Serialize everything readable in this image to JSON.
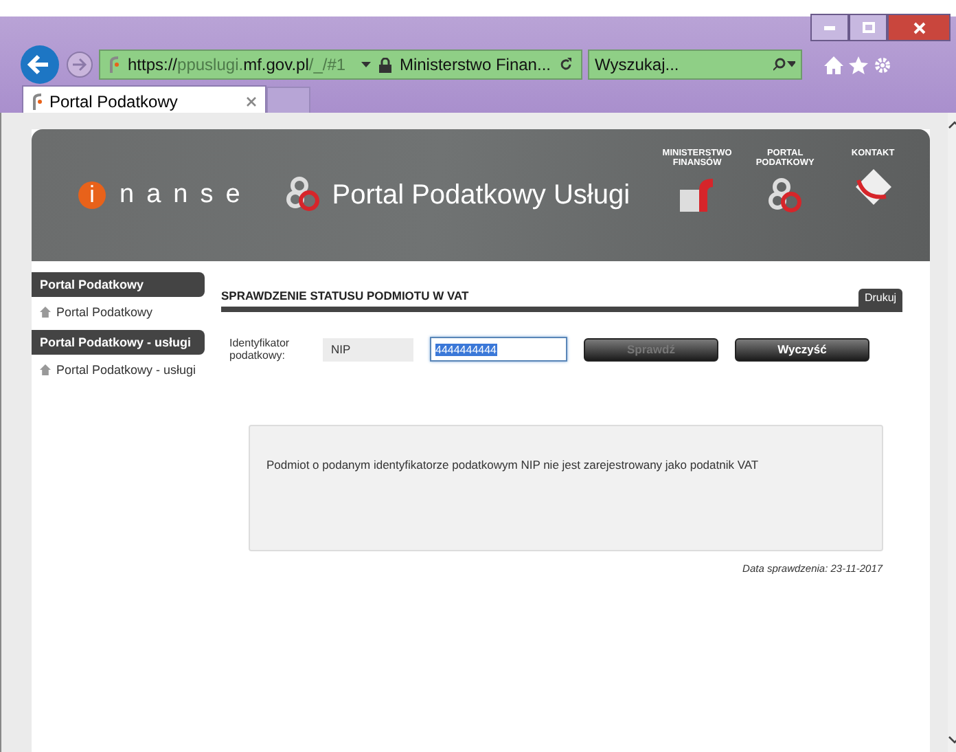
{
  "browser": {
    "url": [
      {
        "text": "https://",
        "dim": false
      },
      {
        "text": "ppuslugi.",
        "dim": true
      },
      {
        "text": "mf.gov.pl",
        "dim": false
      },
      {
        "text": "/_/#1",
        "dim": true
      }
    ],
    "site_identity": "Ministerstwo Finan...",
    "search": {
      "placeholder": "Wyszukaj..."
    },
    "tabs": [
      {
        "label": "Portal Podatkowy",
        "selected": true
      }
    ]
  },
  "header": {
    "logo_mark": "i",
    "logo_text": "nanse",
    "title": "Portal Podatkowy Usługi",
    "nav": [
      {
        "kind": "ministry",
        "label": "MINISTERSTWO FINANSÓW"
      },
      {
        "kind": "portal",
        "label": "PORTAL PODATKOWY"
      },
      {
        "kind": "contact",
        "label": "KONTAKT"
      }
    ]
  },
  "sidebar": {
    "items": [
      {
        "kind": "heading",
        "label": "Portal Podatkowy"
      },
      {
        "kind": "link",
        "label": "Portal Podatkowy"
      },
      {
        "kind": "heading",
        "label": "Portal Podatkowy - usługi"
      },
      {
        "kind": "link",
        "label": "Portal Podatkowy - usługi"
      }
    ]
  },
  "main": {
    "title": "SPRAWDZENIE STATUSU PODMIOTU W VAT",
    "print_button": "Drukuj",
    "form": {
      "label": "Identyfikator podatkowy:",
      "id_type": "NIP",
      "value": "4444444444",
      "value_selected": true,
      "buttons": [
        {
          "label": "Sprawdź",
          "disabled": true
        },
        {
          "label": "Wyczyść",
          "disabled": false
        }
      ]
    },
    "message": "Podmiot o podanym identyfikatorze podatkowym NIP nie jest zarejestrowany jako podatnik VAT",
    "check_date": "Data sprawdzenia: 23-11-2017"
  }
}
